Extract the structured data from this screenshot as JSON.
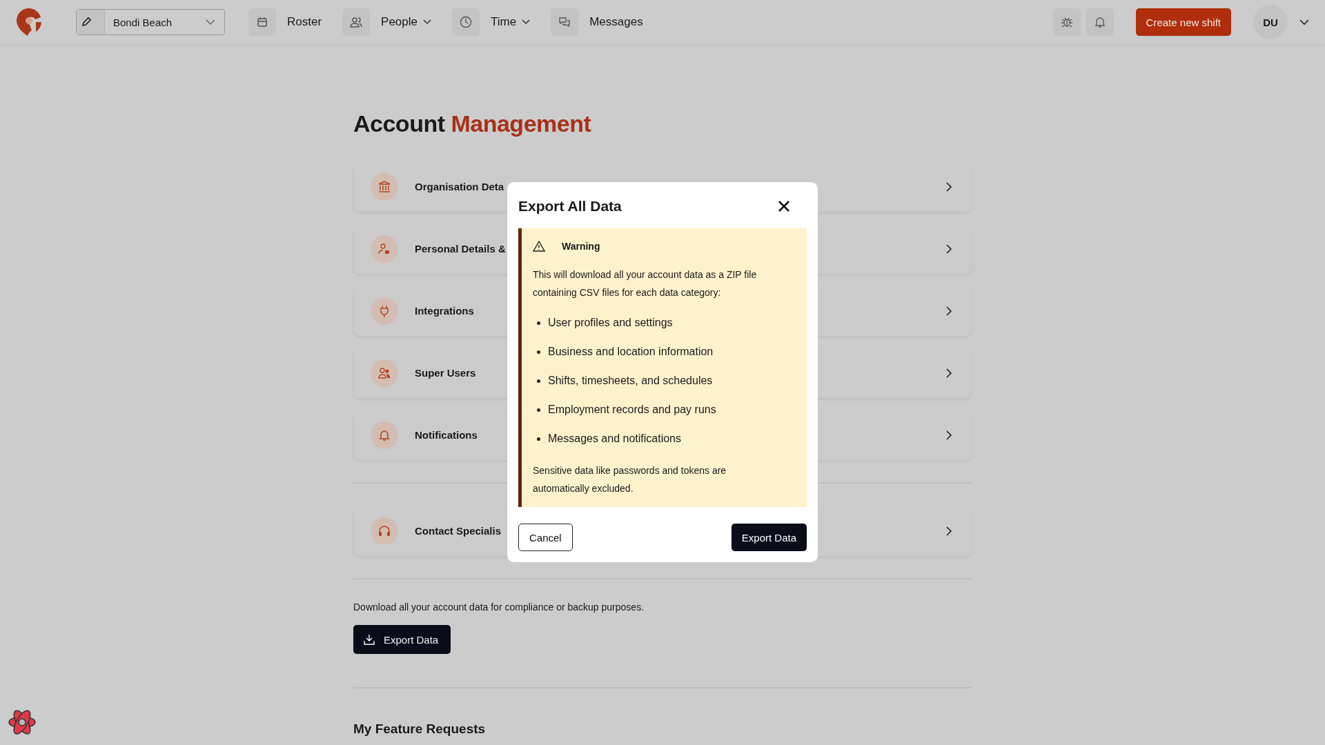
{
  "top_bar": {
    "location": "Bondi Beach",
    "nav": [
      {
        "label": "Roster",
        "dropdown": false
      },
      {
        "label": "People",
        "dropdown": true
      },
      {
        "label": "Time",
        "dropdown": true
      },
      {
        "label": "Messages",
        "dropdown": false
      }
    ],
    "create_button": "Create new shift",
    "avatar": "DU"
  },
  "page": {
    "title_plain": "Account",
    "title_accent": "Management",
    "settings": [
      {
        "label": "Organisation Deta"
      },
      {
        "label": "Personal Details &"
      },
      {
        "label": "Integrations"
      },
      {
        "label": "Super Users"
      },
      {
        "label": "Notifications"
      }
    ],
    "support": [
      {
        "label": "Contact Specialis"
      }
    ],
    "export_description": "Download all your account data for compliance or backup purposes.",
    "export_button": "Export Data",
    "feature_heading": "My Feature Requests"
  },
  "dialog": {
    "title": "Export All Data",
    "warning_label": "Warning",
    "intro": "This will download all your account data as a ZIP file containing CSV files for each data category:",
    "items": [
      "User profiles and settings",
      "Business and location information",
      "Shifts, timesheets, and schedules",
      "Employment records and pay runs",
      "Messages and notifications"
    ],
    "note": "Sensitive data like passwords and tokens are automatically excluded.",
    "cancel": "Cancel",
    "confirm": "Export Data"
  }
}
